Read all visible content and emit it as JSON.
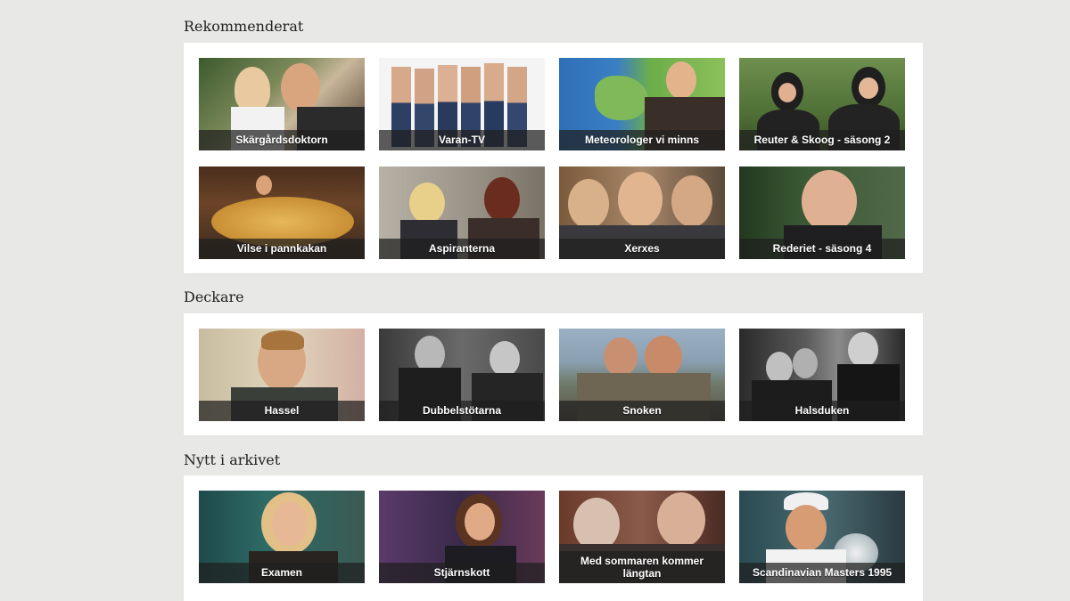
{
  "sections": [
    {
      "title": "Rekommenderat",
      "items": [
        {
          "label": "Skärgårdsdoktorn"
        },
        {
          "label": "Varan-TV"
        },
        {
          "label": "Meteorologer vi minns"
        },
        {
          "label": "Reuter & Skoog - säsong 2"
        },
        {
          "label": "Vilse i pannkakan"
        },
        {
          "label": "Aspiranterna"
        },
        {
          "label": "Xerxes"
        },
        {
          "label": "Rederiet - säsong 4"
        }
      ]
    },
    {
      "title": "Deckare",
      "items": [
        {
          "label": "Hassel"
        },
        {
          "label": "Dubbelstötarna"
        },
        {
          "label": "Snoken"
        },
        {
          "label": "Halsduken"
        }
      ]
    },
    {
      "title": "Nytt i arkivet",
      "items": [
        {
          "label": "Examen"
        },
        {
          "label": "Stjärnskott"
        },
        {
          "label": "Med sommaren kommer längtan"
        },
        {
          "label": "Scandinavian Masters 1995"
        }
      ]
    }
  ]
}
